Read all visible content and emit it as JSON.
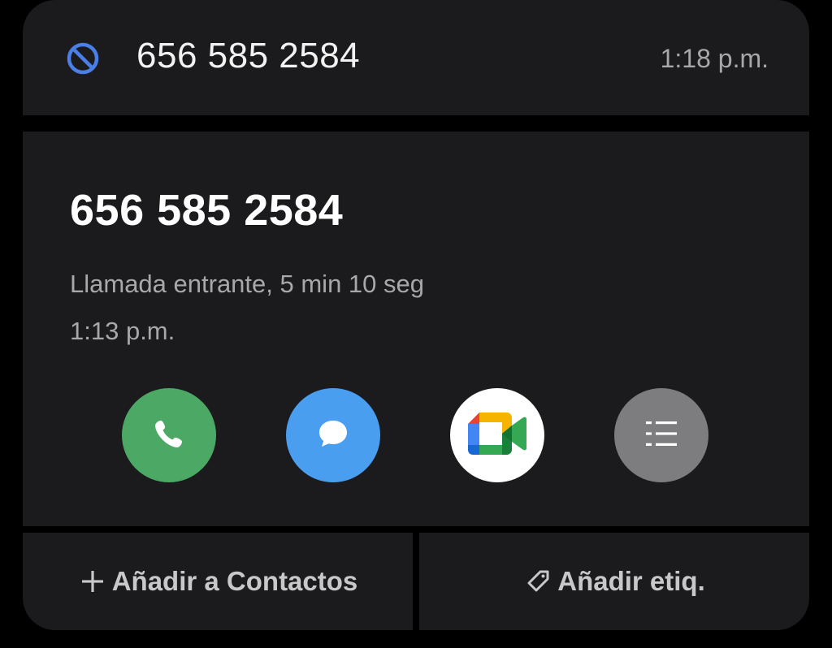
{
  "recent_call": {
    "number": "656 585 2584",
    "time": "1:18 p.m."
  },
  "detail": {
    "number": "656 585 2584",
    "call_info": "Llamada entrante, 5 min 10 seg",
    "call_time": "1:13 p.m."
  },
  "actions": [
    {
      "name": "call",
      "icon": "phone-icon",
      "color": "#4ca865"
    },
    {
      "name": "message",
      "icon": "message-bubble-icon",
      "color": "#4a9ef0"
    },
    {
      "name": "meet",
      "icon": "google-meet-icon",
      "color": "#ffffff"
    },
    {
      "name": "details",
      "icon": "list-icon",
      "color": "#7d7d7f"
    }
  ],
  "footer": {
    "add_contact_label": "Añadir a Contactos",
    "add_tag_label": "Añadir etiq."
  },
  "colors": {
    "background": "#000000",
    "card": "#1b1b1d",
    "blocked_icon": "#4a7fe8",
    "secondary_text": "#a8a8aa"
  }
}
